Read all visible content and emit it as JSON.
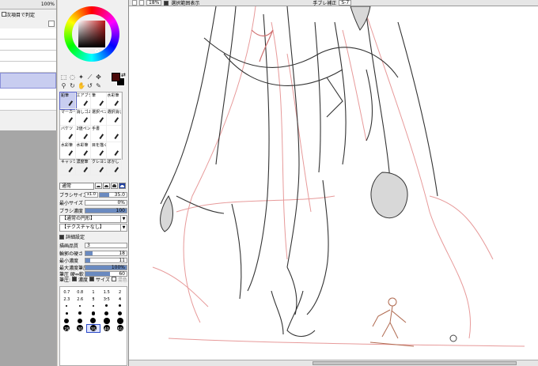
{
  "layer_panel": {
    "top_value": "100%",
    "clip_label": "次項目で判定",
    "rows": [
      "",
      "",
      ""
    ]
  },
  "color": {
    "hue_wheel": "conic",
    "main_color": "#4b0a0a",
    "sub_color": "#000000",
    "accent": "#c01818"
  },
  "brushes": [
    {
      "name": "鉛筆",
      "selected": true
    },
    {
      "name": "エアブラシ",
      "selected": false
    },
    {
      "name": "筆",
      "selected": false
    },
    {
      "name": "水彩筆",
      "selected": false
    },
    {
      "name": "マーカー",
      "selected": false
    },
    {
      "name": "消しゴム",
      "selected": false
    },
    {
      "name": "選択ペン",
      "selected": false
    },
    {
      "name": "選択消し",
      "selected": false
    },
    {
      "name": "バケツ",
      "selected": false
    },
    {
      "name": "2値ペン",
      "selected": false
    },
    {
      "name": "手書",
      "selected": false
    },
    {
      "name": "",
      "selected": false
    },
    {
      "name": "水彩筆",
      "selected": false
    },
    {
      "name": "水彩筆",
      "selected": false
    },
    {
      "name": "目を描く",
      "selected": false
    },
    {
      "name": "",
      "selected": false
    },
    {
      "name": "キャッシュ",
      "selected": false
    },
    {
      "name": "濃度筆",
      "selected": false
    },
    {
      "name": "クレヨン",
      "selected": false
    },
    {
      "name": "ぼかし",
      "selected": false
    }
  ],
  "mode": {
    "label": "通常"
  },
  "props": {
    "brush_size_label": "ブラシサイズ",
    "brush_size_mult": "x1.0",
    "brush_size_value": "35.0",
    "brush_size_fill": 0.35,
    "min_size_label": "最小サイズ",
    "min_size_value": "0%",
    "min_size_fill": 0.0,
    "density_label": "ブラシ濃度",
    "density_value": "100",
    "density_fill": 1.0
  },
  "drop1": "【通常の円形】",
  "drop2": "【テクスチャなし】",
  "detail_label": "詳細設定",
  "quality_label": "描画品質",
  "quality_value": "3",
  "edge_label": "輪郭の硬さ",
  "edge_value": "18",
  "edge_fill": 0.18,
  "min_density_label": "最小濃度",
  "min_density_value": "11",
  "min_density_fill": 0.11,
  "max_density_label": "最大濃度筆圧",
  "max_density_value": "100%",
  "max_density_fill": 1.0,
  "pressure_label": "筆圧 硬⇔軟",
  "pressure_value": "60",
  "pressure_fill": 0.6,
  "pressure_check": "筆圧:",
  "chk_density": "濃度",
  "chk_size": "サイズ",
  "chk_blend": "混色",
  "dot_sizes": [
    {
      "label": "0.7",
      "d": 0
    },
    {
      "label": "0.8",
      "d": 0
    },
    {
      "label": "1",
      "d": 0
    },
    {
      "label": "1.5",
      "d": 0
    },
    {
      "label": "2",
      "d": 0
    },
    {
      "label": "2.3",
      "d": 0
    },
    {
      "label": "2.6",
      "d": 0
    },
    {
      "label": "3",
      "d": 1
    },
    {
      "label": "3.5",
      "d": 1
    },
    {
      "label": "4",
      "d": 1.5
    },
    {
      "label": "",
      "d": 2
    },
    {
      "label": "",
      "d": 2
    },
    {
      "label": "",
      "d": 2.5
    },
    {
      "label": "",
      "d": 3
    },
    {
      "label": "",
      "d": 3
    },
    {
      "label": "",
      "d": 3.5
    },
    {
      "label": "",
      "d": 4
    },
    {
      "label": "",
      "d": 4.5
    },
    {
      "label": "",
      "d": 5
    },
    {
      "label": "",
      "d": 5.5
    },
    {
      "label": "",
      "d": 6
    },
    {
      "label": "",
      "d": 6.5
    },
    {
      "label": "",
      "d": 7
    },
    {
      "label": "",
      "d": 7.5
    },
    {
      "label": "",
      "d": 8
    },
    {
      "label": "25",
      "d": 8
    },
    {
      "label": "30",
      "d": 8
    },
    {
      "label": "35",
      "d": 8,
      "selected": true
    },
    {
      "label": "40",
      "d": 8
    },
    {
      "label": "50",
      "d": 8
    }
  ],
  "topbar": {
    "zoom": "18%",
    "sel_label": "選択範囲表示",
    "stab_label": "手ブレ補正",
    "stab_value": "S-7"
  }
}
